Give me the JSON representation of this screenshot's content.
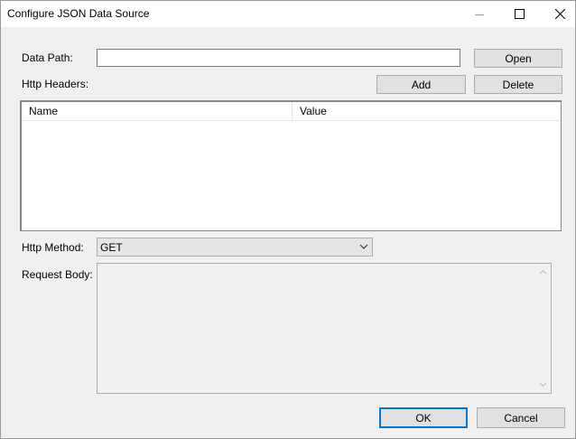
{
  "window": {
    "title": "Configure JSON Data Source"
  },
  "form": {
    "data_path_label": "Data Path:",
    "data_path_value": "",
    "open_label": "Open",
    "http_headers_label": "Http Headers:",
    "add_label": "Add",
    "delete_label": "Delete",
    "headers_table": {
      "columns": [
        "Name",
        "Value"
      ],
      "rows": []
    },
    "http_method_label": "Http Method:",
    "http_method_value": "GET",
    "request_body_label": "Request Body:",
    "request_body_value": ""
  },
  "footer": {
    "ok_label": "OK",
    "cancel_label": "Cancel"
  },
  "icons": {
    "minimize": "minimize-icon",
    "maximize": "maximize-icon",
    "close": "close-icon",
    "dropdown": "chevron-down-icon"
  },
  "colors": {
    "dialog_bg": "#f0f0f0",
    "titlebar_bg": "#ffffff",
    "default_button_border": "#0078d7"
  }
}
